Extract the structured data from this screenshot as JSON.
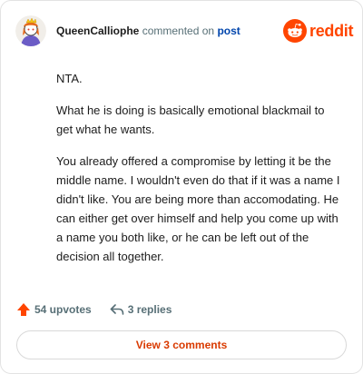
{
  "header": {
    "username": "QueenCalliophe",
    "action": "commented on",
    "post_link": "post",
    "brand": "reddit"
  },
  "comment": {
    "paragraphs": [
      "NTA.",
      "What he is doing is basically emotional blackmail to get what he wants.",
      "You already offered a compromise by letting it be the middle name. I wouldn't even do that if it was a name I didn't like. You are being more than accomodating. He can either get over himself and help you come up with a name you both like, or he can be left out of the decision all together."
    ]
  },
  "footer": {
    "upvotes": "54 upvotes",
    "replies": "3 replies",
    "view_comments": "View 3 comments"
  },
  "colors": {
    "brand": "#ff4500",
    "link": "#0045ac",
    "view_button_text": "#d93a00"
  },
  "icons": {
    "avatar": "avatar-icon",
    "brand": "reddit-snoo-icon",
    "upvote": "upvote-arrow-icon",
    "reply": "reply-arrow-icon"
  }
}
